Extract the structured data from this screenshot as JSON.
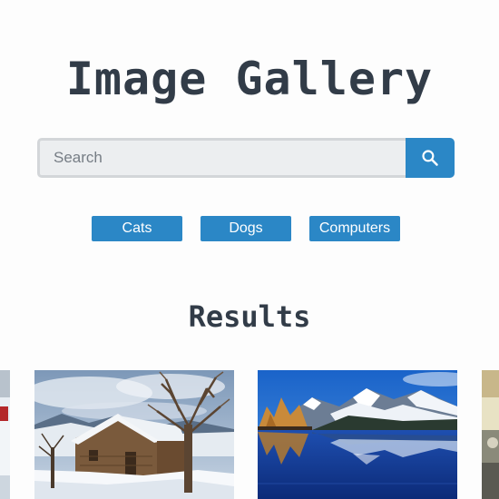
{
  "header": {
    "title": "Image Gallery"
  },
  "search": {
    "placeholder": "Search",
    "value": "",
    "button_icon": "search-icon"
  },
  "tags": [
    {
      "label": "Cats"
    },
    {
      "label": "Dogs"
    },
    {
      "label": "Computers"
    }
  ],
  "results": {
    "heading": "Results",
    "images": [
      {
        "name": "partial-left-image",
        "subject": "winter cabin"
      },
      {
        "name": "winter-cabin-image",
        "subject": "snowy wooden cabin with bare tree"
      },
      {
        "name": "mountain-lake-image",
        "subject": "snowy mountains reflected in blue lake"
      },
      {
        "name": "partial-right-image",
        "subject": "partially visible photo"
      }
    ]
  },
  "colors": {
    "accent": "#2b87c6",
    "title": "#323c48",
    "input_bg": "#eceef0"
  }
}
